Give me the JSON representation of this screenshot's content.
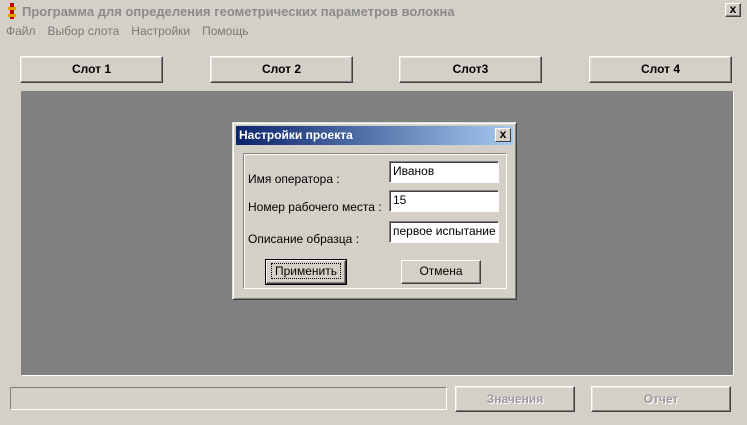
{
  "window": {
    "title": "Программа для определения геометрических параметров волокна",
    "close_label": "x"
  },
  "menu": {
    "items": [
      "Файл",
      "Выбор слота",
      "Настройки",
      "Помощь"
    ]
  },
  "slots": {
    "items": [
      "Слот 1",
      "Слот 2",
      "Слот3",
      "Слот 4"
    ]
  },
  "bottom": {
    "status_text": "",
    "values_label": "Значения",
    "report_label": "Отчет"
  },
  "dialog": {
    "title": "Настройки проекта",
    "close_label": "x",
    "operator_label": "Имя оператора :",
    "operator_value": "Иванов",
    "workplace_label": "Номер рабочего места :",
    "workplace_value": "15",
    "sample_label": "Описание образца :",
    "sample_value": "первое испытание",
    "apply_label": "Применить",
    "cancel_label": "Отмена"
  },
  "colors": {
    "face": "#d4d0c8",
    "workarea": "#808080",
    "dialog_title_start": "#0a246a",
    "dialog_title_end": "#a6caf0"
  }
}
